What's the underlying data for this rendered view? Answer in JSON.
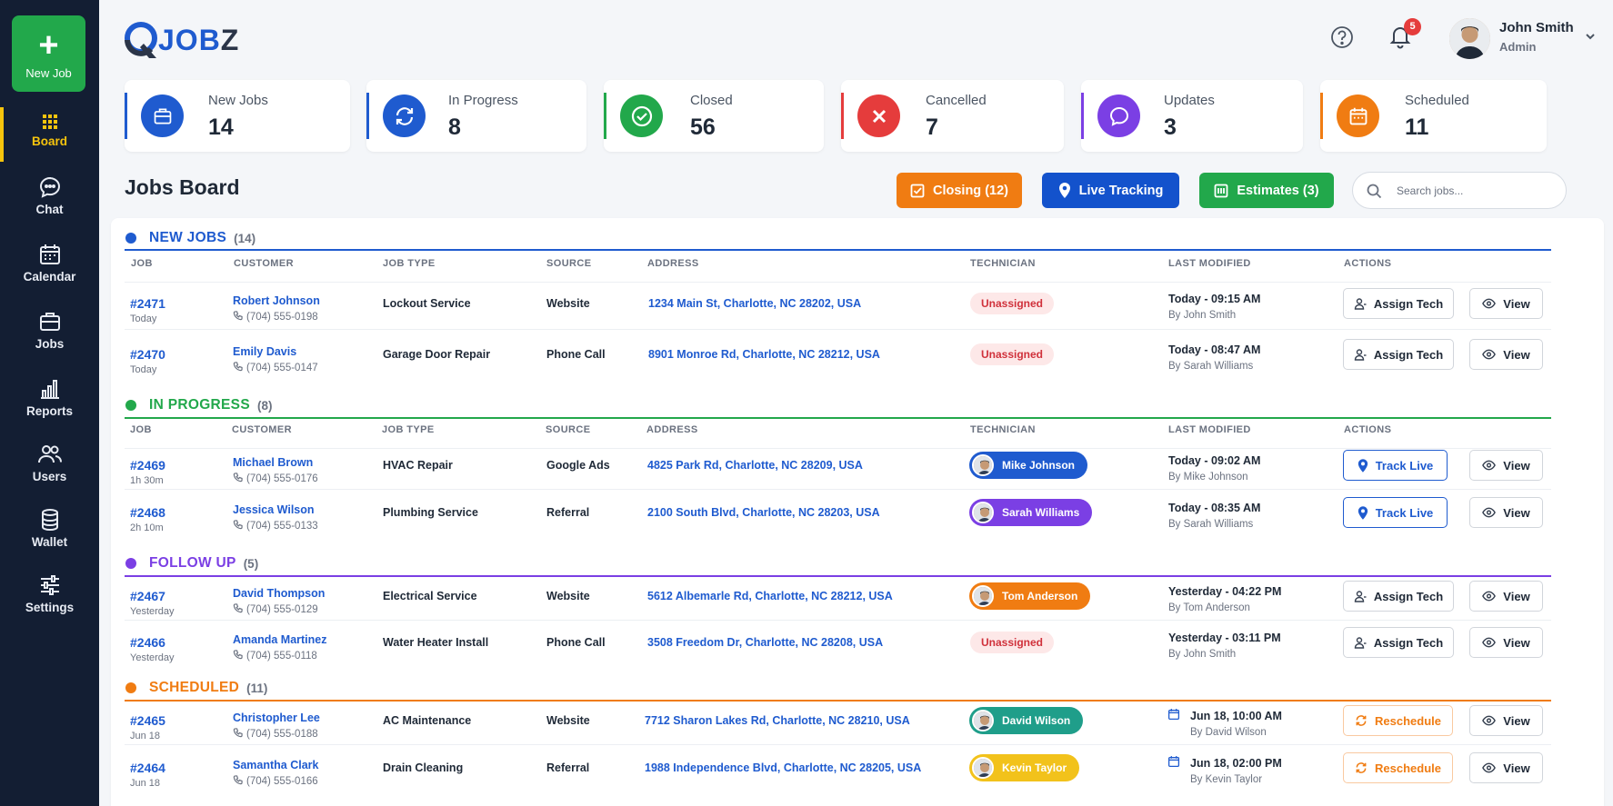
{
  "sidebar": {
    "new_job_label": "New Job",
    "items": [
      {
        "label": "Board",
        "icon": "grid-icon",
        "active": true
      },
      {
        "label": "Chat",
        "icon": "chat-icon"
      },
      {
        "label": "Calendar",
        "icon": "calendar-icon"
      },
      {
        "label": "Jobs",
        "icon": "briefcase-icon"
      },
      {
        "label": "Reports",
        "icon": "bar-chart-icon"
      },
      {
        "label": "Users",
        "icon": "users-icon"
      },
      {
        "label": "Wallet",
        "icon": "database-icon"
      },
      {
        "label": "Settings",
        "icon": "sliders-icon"
      }
    ]
  },
  "header": {
    "logo_text_a": "JOB",
    "logo_text_b": "Z",
    "notification_count": "5",
    "user_name": "John Smith",
    "user_role": "Admin"
  },
  "stats": [
    {
      "title": "New Jobs",
      "value": "14",
      "color": "#1f5bcf",
      "icon": "briefcase-icon"
    },
    {
      "title": "In Progress",
      "value": "8",
      "color": "#1f5bcf",
      "icon": "refresh-icon"
    },
    {
      "title": "Closed",
      "value": "56",
      "color": "#22a84b",
      "icon": "check-circle-icon"
    },
    {
      "title": "Cancelled",
      "value": "7",
      "color": "#e53c3c",
      "icon": "x-icon"
    },
    {
      "title": "Updates",
      "value": "3",
      "color": "#7b3fe4",
      "icon": "message-icon"
    },
    {
      "title": "Scheduled",
      "value": "11",
      "color": "#f07c12",
      "icon": "calendar-icon"
    }
  ],
  "board": {
    "title": "Jobs Board",
    "closing_label": "Closing (12)",
    "tracking_label": "Live Tracking",
    "estimates_label": "Estimates (3)",
    "search_placeholder": "Search jobs..."
  },
  "columns": [
    "JOB",
    "CUSTOMER",
    "JOB TYPE",
    "SOURCE",
    "ADDRESS",
    "TECHNICIAN",
    "LAST MODIFIED",
    "ACTIONS"
  ],
  "sections": [
    {
      "name": "NEW JOBS",
      "count": "(14)",
      "color": "#1f5bcf",
      "rows": [
        {
          "job": "#2471",
          "sub": "Today",
          "customer": "Robert Johnson",
          "phone": "(704) 555-0198",
          "type": "Lockout Service",
          "source": "Website",
          "address": "1234 Main St, Charlotte, NC 28202, USA",
          "tech": "Unassigned",
          "mod": "Today - 09:15 AM",
          "by": "By John Smith",
          "action": "Assign Tech",
          "view": "View"
        },
        {
          "job": "#2470",
          "sub": "Today",
          "customer": "Emily Davis",
          "phone": "(704) 555-0147",
          "type": "Garage Door Repair",
          "source": "Phone Call",
          "address": "8901 Monroe Rd, Charlotte, NC 28212, USA",
          "tech": "Unassigned",
          "mod": "Today - 08:47 AM",
          "by": "By Sarah Williams",
          "action": "Assign Tech",
          "view": "View"
        }
      ]
    },
    {
      "name": "IN PROGRESS",
      "count": "(8)",
      "color": "#22a84b",
      "rows": [
        {
          "job": "#2469",
          "sub": "1h 30m",
          "customer": "Michael Brown",
          "phone": "(704) 555-0176",
          "type": "HVAC Repair",
          "source": "Google Ads",
          "address": "4825 Park Rd, Charlotte, NC 28209, USA",
          "tech": "Mike Johnson",
          "tech_color": "#1f5bcf",
          "mod": "Today - 09:02 AM",
          "by": "By Mike Johnson",
          "action": "Track Live",
          "view": "View"
        },
        {
          "job": "#2468",
          "sub": "2h 10m",
          "customer": "Jessica Wilson",
          "phone": "(704) 555-0133",
          "type": "Plumbing Service",
          "source": "Referral",
          "address": "2100 South Blvd, Charlotte, NC 28203, USA",
          "tech": "Sarah Williams",
          "tech_color": "#7b3fe4",
          "mod": "Today - 08:35 AM",
          "by": "By Sarah Williams",
          "action": "Track Live",
          "view": "View"
        }
      ]
    },
    {
      "name": "FOLLOW UP",
      "count": "(5)",
      "color": "#7b3fe4",
      "rows": [
        {
          "job": "#2467",
          "sub": "Yesterday",
          "customer": "David Thompson",
          "phone": "(704) 555-0129",
          "type": "Electrical Service",
          "source": "Website",
          "address": "5612 Albemarle Rd, Charlotte, NC 28212, USA",
          "tech": "Tom Anderson",
          "tech_color": "#f07c12",
          "mod": "Yesterday - 04:22 PM",
          "by": "By Tom Anderson",
          "action": "Assign Tech",
          "view": "View"
        },
        {
          "job": "#2466",
          "sub": "Yesterday",
          "customer": "Amanda Martinez",
          "phone": "(704) 555-0118",
          "type": "Water Heater Install",
          "source": "Phone Call",
          "address": "3508 Freedom Dr, Charlotte, NC 28208, USA",
          "tech": "Unassigned",
          "mod": "Yesterday - 03:11 PM",
          "by": "By John Smith",
          "action": "Assign Tech",
          "view": "View"
        }
      ]
    },
    {
      "name": "SCHEDULED",
      "count": "(11)",
      "color": "#f07c12",
      "rows": [
        {
          "job": "#2465",
          "sub": "Jun 18",
          "customer": "Christopher Lee",
          "phone": "(704) 555-0188",
          "type": "AC Maintenance",
          "source": "Website",
          "address": "7712 Sharon Lakes Rd, Charlotte, NC 28210, USA",
          "tech": "David Wilson",
          "tech_color": "#1f9e8a",
          "mod": "Jun 18, 10:00 AM",
          "by": "By David Wilson",
          "action": "Reschedule",
          "view": "View"
        },
        {
          "job": "#2464",
          "sub": "Jun 18",
          "customer": "Samantha Clark",
          "phone": "(704) 555-0166",
          "type": "Drain Cleaning",
          "source": "Referral",
          "address": "1988 Independence Blvd, Charlotte, NC 28205, USA",
          "tech": "Kevin Taylor",
          "tech_color": "#f2c21b",
          "mod": "Jun 18, 02:00 PM",
          "by": "By Kevin Taylor",
          "action": "Reschedule",
          "view": "View"
        }
      ]
    }
  ]
}
